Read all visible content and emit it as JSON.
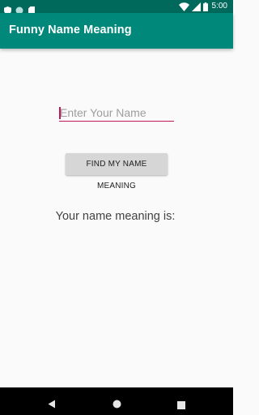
{
  "status_bar": {
    "time": "5:00",
    "left_icons": [
      "shield-icon",
      "circle-icon",
      "sd-card-icon"
    ],
    "right_icons": [
      "wifi-icon",
      "signal-icon",
      "battery-icon"
    ]
  },
  "app_bar": {
    "title": "Funny Name Meaning",
    "color": "#00897b",
    "status_color": "#00695c"
  },
  "main": {
    "name_input": {
      "placeholder": "Enter Your Name",
      "value": ""
    },
    "find_button_label": "FIND MY NAME MEANING",
    "result_label": "Your name meaning is:",
    "accent_color": "#c2185b"
  },
  "nav_bar": {
    "buttons": [
      "back-icon",
      "home-icon",
      "recents-icon"
    ]
  }
}
